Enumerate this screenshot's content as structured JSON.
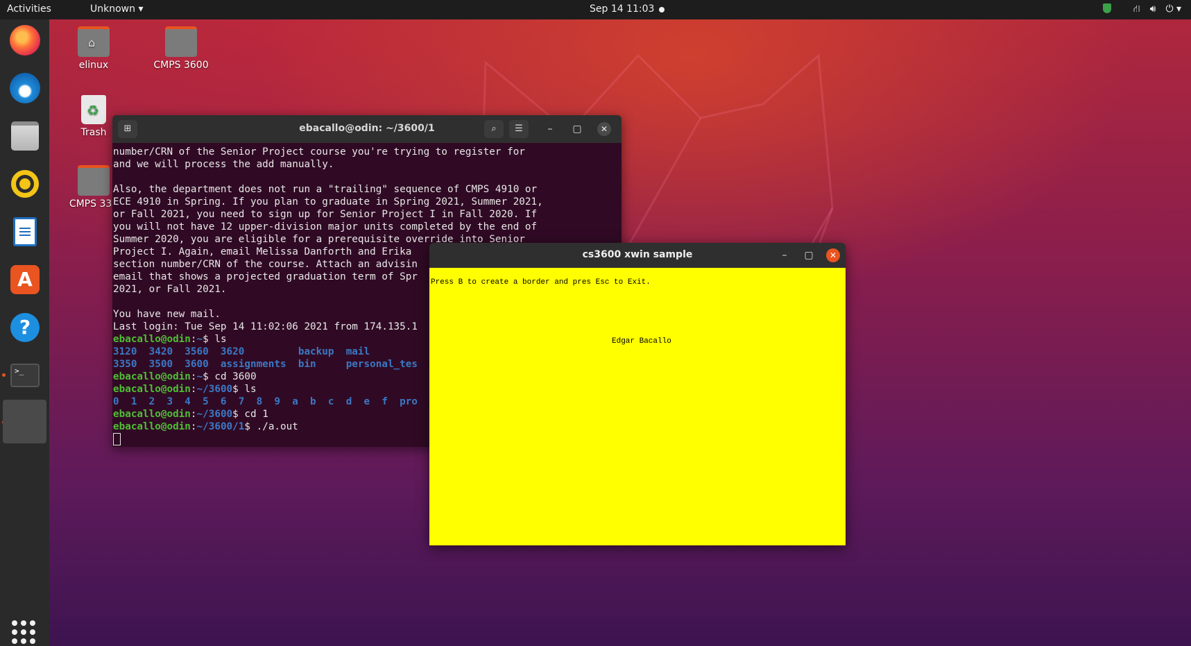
{
  "topbar": {
    "activities": "Activities",
    "app_menu": "Unknown ▾",
    "clock": "Sep 14  11:03",
    "tray": [
      "network-icon",
      "volume-icon",
      "power-icon"
    ]
  },
  "dock": {
    "items": [
      "firefox-icon",
      "thunderbird-icon",
      "files-icon",
      "rhythmbox-icon",
      "writer-icon",
      "software-icon",
      "help-icon",
      "terminal-icon",
      "active-app-icon"
    ],
    "terminal_glyph": ">_"
  },
  "desktop": {
    "icons": [
      {
        "label": "elinux"
      },
      {
        "label": "CMPS 3600"
      },
      {
        "label": "Trash"
      },
      {
        "label": "CMPS 335"
      }
    ]
  },
  "terminal": {
    "title": "ebacallo@odin: ~/3600/1",
    "lines": [
      "number/CRN of the Senior Project course you're trying to register for",
      "and we will process the add manually.",
      "",
      "Also, the department does not run a \"trailing\" sequence of CMPS 4910 or",
      "ECE 4910 in Spring. If you plan to graduate in Spring 2021, Summer 2021,",
      "or Fall 2021, you need to sign up for Senior Project I in Fall 2020. If",
      "you will not have 12 upper-division major units completed by the end of",
      "Summer 2020, you are eligible for a prerequisite override into Senior",
      "Project I. Again, email Melissa Danforth and Erika",
      "section number/CRN of the course. Attach an advisin",
      "email that shows a projected graduation term of Spr",
      "2021, or Fall 2021.",
      "",
      "You have new mail.",
      "Last login: Tue Sep 14 11:02:06 2021 from 174.135.1"
    ],
    "prompt_user": "ebacallo@odin",
    "cmd1_path": "~",
    "cmd1": "ls",
    "ls1_row1": "3120  3420  3560  3620         backup  mail",
    "ls1_row2": "3350  3500  3600  assignments  bin     personal_tes",
    "cmd2_path": "~",
    "cmd2": "cd 3600",
    "cmd3_path": "~/3600",
    "cmd3": "ls",
    "ls2_row": "0  1  2  3  4  5  6  7  8  9  a  b  c  d  e  f  pro",
    "cmd4_path": "~/3600",
    "cmd4": "cd 1",
    "cmd5_path": "~/3600/1",
    "cmd5": "./a.out"
  },
  "xwin": {
    "title": "cs3600 xwin sample",
    "message": "Press B to create a border and pres Esc to Exit.",
    "name": "Edgar Bacallo",
    "bg_color": "#ffff00"
  }
}
